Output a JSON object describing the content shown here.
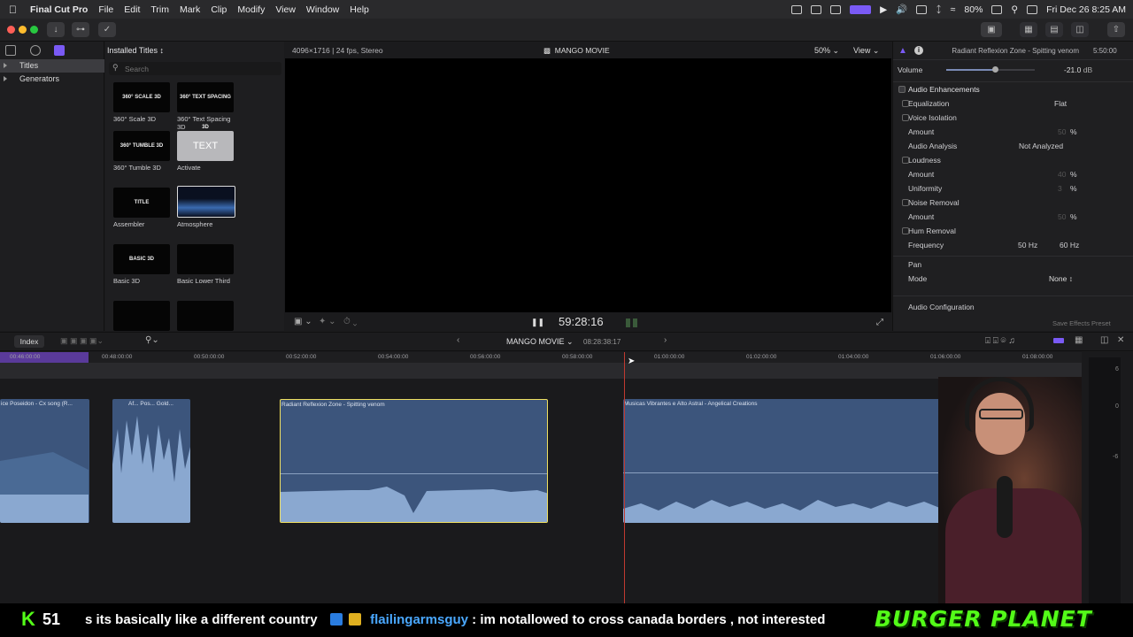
{
  "menubar": {
    "app_name": "Final Cut Pro",
    "items": [
      "File",
      "Edit",
      "Trim",
      "Mark",
      "Clip",
      "Modify",
      "View",
      "Window",
      "Help"
    ],
    "battery": "80%",
    "datetime": "Fri Dec 26  8:25 AM"
  },
  "browser": {
    "sidebar": [
      {
        "label": "Titles",
        "selected": true
      },
      {
        "label": "Generators",
        "selected": false
      }
    ],
    "header": "Installed Titles",
    "search_placeholder": "Search",
    "titles": [
      {
        "name": "360° Scale 3D",
        "thumb_text": "360° SCALE 3D"
      },
      {
        "name": "360° Text Spacing 3D",
        "thumb_text": "360° TEXT SPACING 3D"
      },
      {
        "name": "360° Tumble 3D",
        "thumb_text": "360° TUMBLE 3D"
      },
      {
        "name": "Activate",
        "thumb_text": "TEXT"
      },
      {
        "name": "Assembler",
        "thumb_text": "TITLE"
      },
      {
        "name": "Atmosphere",
        "thumb_text": ""
      },
      {
        "name": "Basic 3D",
        "thumb_text": "BASIC 3D"
      },
      {
        "name": "Basic Lower Third",
        "thumb_text": ""
      },
      {
        "name": "",
        "thumb_text": ""
      },
      {
        "name": "",
        "thumb_text": ""
      }
    ]
  },
  "viewer": {
    "format": "4096×1716 | 24 fps, Stereo",
    "project": "MANGO MOVIE",
    "zoom": "50%",
    "view_label": "View",
    "timecode": "59:28:16"
  },
  "inspector": {
    "clip_title": "Radiant Reflexion Zone - Spitting venom",
    "clip_duration": "5:50:00",
    "volume_label": "Volume",
    "volume_value": "-21.0",
    "volume_unit": "dB",
    "volume_level": 0.55,
    "section_title": "Audio Enhancements",
    "rows": [
      {
        "label": "Equalization",
        "checkbox": true,
        "value": "Flat",
        "indent": false
      },
      {
        "label": "Voice Isolation",
        "checkbox": true,
        "value": "",
        "indent": false
      },
      {
        "label": "Amount",
        "checkbox": false,
        "value": "50",
        "unit": "%",
        "indent": true
      },
      {
        "label": "Audio Analysis",
        "checkbox": false,
        "value": "Not Analyzed",
        "indent": true
      },
      {
        "label": "Loudness",
        "checkbox": true,
        "value": "",
        "indent": false
      },
      {
        "label": "Amount",
        "checkbox": false,
        "value": "40",
        "unit": "%",
        "indent": true
      },
      {
        "label": "Uniformity",
        "checkbox": false,
        "value": "3",
        "unit": "%",
        "indent": true
      },
      {
        "label": "Noise Removal",
        "checkbox": true,
        "value": "",
        "indent": false
      },
      {
        "label": "Amount",
        "checkbox": false,
        "value": "50",
        "unit": "%",
        "indent": true
      },
      {
        "label": "Hum Removal",
        "checkbox": true,
        "value": "",
        "indent": false
      },
      {
        "label": "Frequency",
        "checkbox": false,
        "value": "50 Hz",
        "value2": "60 Hz",
        "indent": true
      }
    ],
    "pan_title": "Pan",
    "mode_label": "Mode",
    "mode_value": "None",
    "audio_config": "Audio Configuration",
    "save_preset": "Save Effects Preset"
  },
  "timeline": {
    "index_label": "Index",
    "project": "MANGO MOVIE",
    "position": "08:28:38:17",
    "ruler": [
      "00:46:00:00",
      "00:48:00:00",
      "00:50:00:00",
      "00:52:00:00",
      "00:54:00:00",
      "00:56:00:00",
      "00:58:00:00",
      "01:00:00:00",
      "01:02:00:00",
      "01:04:00:00",
      "01:06:00:00",
      "01:08:00:00"
    ],
    "clips": [
      {
        "name": "ice Poseidon - Cx song (R..."
      },
      {
        "name": "Af...  Pos...  Gold..."
      },
      {
        "name": "Radiant Reflexion Zone - Spitting venom"
      },
      {
        "name": "Musicas Vibrantes e Alto Astral - Angelical Creations"
      }
    ],
    "meter_labels": [
      "6",
      "0",
      "-6"
    ]
  },
  "ticker": {
    "badge_letter": "K",
    "badge_number": "51",
    "message_tail": "s its basically like a different country",
    "username": "flailingarmsguy",
    "message": ": im notallowed to cross canada borders , not interested",
    "brand": "BURGER PLANET"
  }
}
